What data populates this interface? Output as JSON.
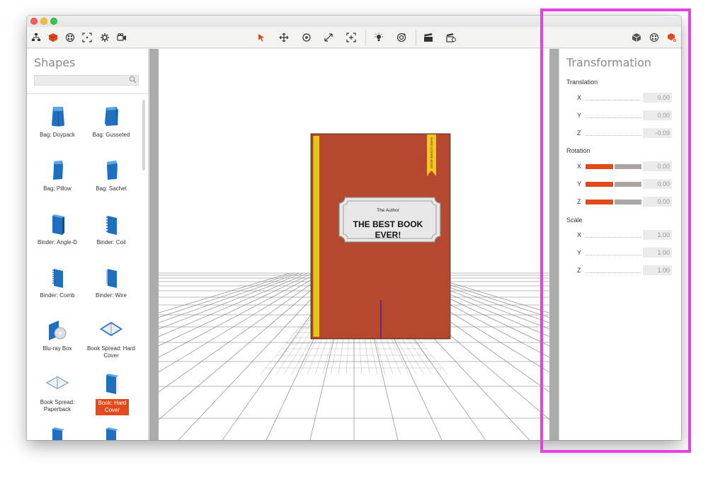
{
  "toolbar": {
    "left_icons": [
      "scene-tree-icon",
      "shape-cube-icon",
      "materials-icon",
      "bounding-box-icon",
      "settings-gear-icon",
      "camera-icon"
    ],
    "center_icons": [
      "select-arrow-icon",
      "move-icon",
      "rotate-icon",
      "scale-icon",
      "fit-icon",
      "light-icon",
      "environment-icon",
      "render-clapper-icon",
      "animation-icon"
    ],
    "right_icons": [
      "object-info-icon",
      "material-panel-icon",
      "transform-panel-icon"
    ]
  },
  "shapes_panel": {
    "title": "Shapes",
    "search_placeholder": "",
    "items": [
      {
        "label": "Bag: Doypack",
        "icon": "bag-doypack-icon"
      },
      {
        "label": "Bag: Gusseted",
        "icon": "bag-gusseted-icon"
      },
      {
        "label": "Bag: Pillow",
        "icon": "bag-pillow-icon"
      },
      {
        "label": "Bag: Sachet",
        "icon": "bag-sachet-icon"
      },
      {
        "label": "Binder: Angle-D",
        "icon": "binder-angle-d-icon"
      },
      {
        "label": "Binder: Coil",
        "icon": "binder-coil-icon"
      },
      {
        "label": "Binder: Comb",
        "icon": "binder-comb-icon"
      },
      {
        "label": "Binder: Wire",
        "icon": "binder-wire-icon"
      },
      {
        "label": "Blu-ray Box",
        "icon": "bluray-box-icon"
      },
      {
        "label": "Book Spread: Hard Cover",
        "icon": "book-spread-hard-icon"
      },
      {
        "label": "Book Spread: Paperback",
        "icon": "book-spread-paperback-icon"
      },
      {
        "label": "Book: Hard Cover",
        "icon": "book-hard-cover-icon",
        "selected": true
      }
    ]
  },
  "viewport": {
    "book": {
      "author": "The Author",
      "title_line1": "THE BEST BOOK",
      "title_line2": "EVER!",
      "ribbon_text": "HARD COVER BOOK",
      "cover_color": "#b5482d",
      "spine_color": "#e8c31a"
    }
  },
  "transformation": {
    "title": "Transformation",
    "translation_label": "Translation",
    "translation": {
      "x": "0.00",
      "y": "0.00",
      "z": "-0.09"
    },
    "rotation_label": "Rotation",
    "rotation": {
      "x": "0.00",
      "y": "0.00",
      "z": "0.00"
    },
    "scale_label": "Scale",
    "scale": {
      "x": "1.00",
      "y": "1.00",
      "z": "1.00"
    },
    "axis_labels": {
      "x": "X",
      "y": "Y",
      "z": "Z"
    }
  },
  "colors": {
    "accent": "#e24a1b",
    "highlight": "#e542e6",
    "shape_blue": "#1e6fbf"
  }
}
